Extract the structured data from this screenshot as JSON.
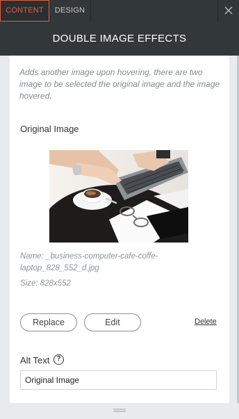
{
  "tabs": [
    {
      "label": "CONTENT",
      "active": true
    },
    {
      "label": "DESIGN",
      "active": false
    }
  ],
  "header": {
    "title": "DOUBLE IMAGE EFFECTS"
  },
  "description": "Adds another image upon hovering, there are two image to be selected the original image and the image hovered.",
  "original_image": {
    "label": "Original Image",
    "name_line1": "Name: _business-computer-cafe-coffe-",
    "name_line2": "laptop_828_552_d.jpg",
    "size": "Size: 828x552"
  },
  "actions": {
    "replace_label": "Replace",
    "edit_label": "Edit",
    "delete_label": "Delete"
  },
  "alt_text": {
    "label": "Alt Text",
    "help_glyph": "?",
    "value": "Original Image"
  },
  "icons": {
    "close": "close-icon",
    "help": "help-icon",
    "drag": "drag-handle-icon"
  },
  "colors": {
    "accent": "#e35d3b",
    "dark_bar": "#323739",
    "panel_bg": "#ffffff"
  }
}
